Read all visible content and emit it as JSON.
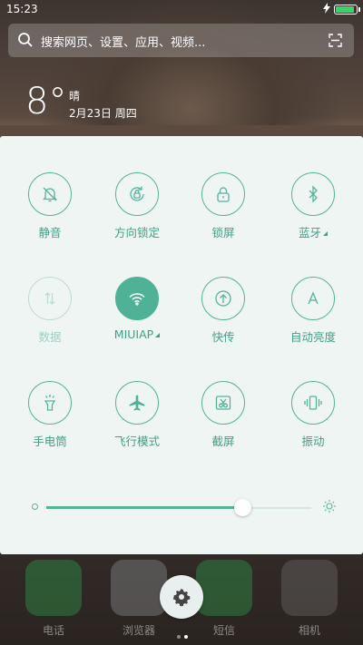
{
  "status_bar": {
    "time": "15:23",
    "charging_icon": "lightning-icon",
    "battery_color": "#3ad36a"
  },
  "search": {
    "placeholder": "搜索网页、设置、应用、视频..."
  },
  "weather": {
    "temperature": "8°",
    "condition": "晴",
    "date": "2月23日 周四"
  },
  "dock": {
    "apps": [
      "电话",
      "浏览器",
      "短信",
      "相机"
    ]
  },
  "toggles": [
    {
      "label": "静音",
      "icon": "bell-mute-icon",
      "state": "off"
    },
    {
      "label": "方向锁定",
      "icon": "rotation-lock-icon",
      "state": "off"
    },
    {
      "label": "锁屏",
      "icon": "lock-icon",
      "state": "off"
    },
    {
      "label": "蓝牙",
      "icon": "bluetooth-icon",
      "state": "off",
      "has_more": true
    },
    {
      "label": "数据",
      "icon": "mobile-data-icon",
      "state": "disabled"
    },
    {
      "label": "MIUIAP",
      "icon": "wifi-icon",
      "state": "on",
      "has_more": true
    },
    {
      "label": "快传",
      "icon": "quick-transfer-icon",
      "state": "off"
    },
    {
      "label": "自动亮度",
      "icon": "auto-brightness-icon",
      "state": "off"
    },
    {
      "label": "手电筒",
      "icon": "flashlight-icon",
      "state": "off"
    },
    {
      "label": "飞行模式",
      "icon": "airplane-icon",
      "state": "off"
    },
    {
      "label": "截屏",
      "icon": "screenshot-icon",
      "state": "off"
    },
    {
      "label": "振动",
      "icon": "vibrate-icon",
      "state": "off"
    }
  ],
  "brightness": {
    "level": 0.74
  },
  "pager": {
    "pages": 2,
    "current": 2
  },
  "colors": {
    "accent": "#4fb196",
    "panel_bg": "#eef5f3",
    "label": "#3f9f86"
  }
}
